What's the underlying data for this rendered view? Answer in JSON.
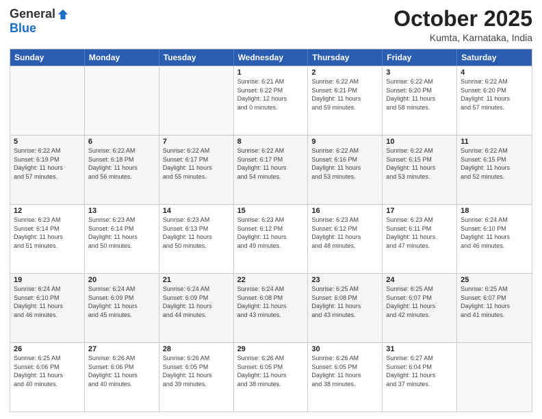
{
  "logo": {
    "general": "General",
    "blue": "Blue"
  },
  "title": "October 2025",
  "location": "Kumta, Karnataka, India",
  "days_of_week": [
    "Sunday",
    "Monday",
    "Tuesday",
    "Wednesday",
    "Thursday",
    "Friday",
    "Saturday"
  ],
  "weeks": [
    [
      {
        "day": "",
        "info": ""
      },
      {
        "day": "",
        "info": ""
      },
      {
        "day": "",
        "info": ""
      },
      {
        "day": "1",
        "info": "Sunrise: 6:21 AM\nSunset: 6:22 PM\nDaylight: 12 hours\nand 0 minutes."
      },
      {
        "day": "2",
        "info": "Sunrise: 6:22 AM\nSunset: 6:21 PM\nDaylight: 11 hours\nand 59 minutes."
      },
      {
        "day": "3",
        "info": "Sunrise: 6:22 AM\nSunset: 6:20 PM\nDaylight: 11 hours\nand 58 minutes."
      },
      {
        "day": "4",
        "info": "Sunrise: 6:22 AM\nSunset: 6:20 PM\nDaylight: 11 hours\nand 57 minutes."
      }
    ],
    [
      {
        "day": "5",
        "info": "Sunrise: 6:22 AM\nSunset: 6:19 PM\nDaylight: 11 hours\nand 57 minutes."
      },
      {
        "day": "6",
        "info": "Sunrise: 6:22 AM\nSunset: 6:18 PM\nDaylight: 11 hours\nand 56 minutes."
      },
      {
        "day": "7",
        "info": "Sunrise: 6:22 AM\nSunset: 6:17 PM\nDaylight: 11 hours\nand 55 minutes."
      },
      {
        "day": "8",
        "info": "Sunrise: 6:22 AM\nSunset: 6:17 PM\nDaylight: 11 hours\nand 54 minutes."
      },
      {
        "day": "9",
        "info": "Sunrise: 6:22 AM\nSunset: 6:16 PM\nDaylight: 11 hours\nand 53 minutes."
      },
      {
        "day": "10",
        "info": "Sunrise: 6:22 AM\nSunset: 6:15 PM\nDaylight: 11 hours\nand 53 minutes."
      },
      {
        "day": "11",
        "info": "Sunrise: 6:22 AM\nSunset: 6:15 PM\nDaylight: 11 hours\nand 52 minutes."
      }
    ],
    [
      {
        "day": "12",
        "info": "Sunrise: 6:23 AM\nSunset: 6:14 PM\nDaylight: 11 hours\nand 51 minutes."
      },
      {
        "day": "13",
        "info": "Sunrise: 6:23 AM\nSunset: 6:14 PM\nDaylight: 11 hours\nand 50 minutes."
      },
      {
        "day": "14",
        "info": "Sunrise: 6:23 AM\nSunset: 6:13 PM\nDaylight: 11 hours\nand 50 minutes."
      },
      {
        "day": "15",
        "info": "Sunrise: 6:23 AM\nSunset: 6:12 PM\nDaylight: 11 hours\nand 49 minutes."
      },
      {
        "day": "16",
        "info": "Sunrise: 6:23 AM\nSunset: 6:12 PM\nDaylight: 11 hours\nand 48 minutes."
      },
      {
        "day": "17",
        "info": "Sunrise: 6:23 AM\nSunset: 6:11 PM\nDaylight: 11 hours\nand 47 minutes."
      },
      {
        "day": "18",
        "info": "Sunrise: 6:24 AM\nSunset: 6:10 PM\nDaylight: 11 hours\nand 46 minutes."
      }
    ],
    [
      {
        "day": "19",
        "info": "Sunrise: 6:24 AM\nSunset: 6:10 PM\nDaylight: 11 hours\nand 46 minutes."
      },
      {
        "day": "20",
        "info": "Sunrise: 6:24 AM\nSunset: 6:09 PM\nDaylight: 11 hours\nand 45 minutes."
      },
      {
        "day": "21",
        "info": "Sunrise: 6:24 AM\nSunset: 6:09 PM\nDaylight: 11 hours\nand 44 minutes."
      },
      {
        "day": "22",
        "info": "Sunrise: 6:24 AM\nSunset: 6:08 PM\nDaylight: 11 hours\nand 43 minutes."
      },
      {
        "day": "23",
        "info": "Sunrise: 6:25 AM\nSunset: 6:08 PM\nDaylight: 11 hours\nand 43 minutes."
      },
      {
        "day": "24",
        "info": "Sunrise: 6:25 AM\nSunset: 6:07 PM\nDaylight: 11 hours\nand 42 minutes."
      },
      {
        "day": "25",
        "info": "Sunrise: 6:25 AM\nSunset: 6:07 PM\nDaylight: 11 hours\nand 41 minutes."
      }
    ],
    [
      {
        "day": "26",
        "info": "Sunrise: 6:25 AM\nSunset: 6:06 PM\nDaylight: 11 hours\nand 40 minutes."
      },
      {
        "day": "27",
        "info": "Sunrise: 6:26 AM\nSunset: 6:06 PM\nDaylight: 11 hours\nand 40 minutes."
      },
      {
        "day": "28",
        "info": "Sunrise: 6:26 AM\nSunset: 6:05 PM\nDaylight: 11 hours\nand 39 minutes."
      },
      {
        "day": "29",
        "info": "Sunrise: 6:26 AM\nSunset: 6:05 PM\nDaylight: 11 hours\nand 38 minutes."
      },
      {
        "day": "30",
        "info": "Sunrise: 6:26 AM\nSunset: 6:05 PM\nDaylight: 11 hours\nand 38 minutes."
      },
      {
        "day": "31",
        "info": "Sunrise: 6:27 AM\nSunset: 6:04 PM\nDaylight: 11 hours\nand 37 minutes."
      },
      {
        "day": "",
        "info": ""
      }
    ]
  ]
}
